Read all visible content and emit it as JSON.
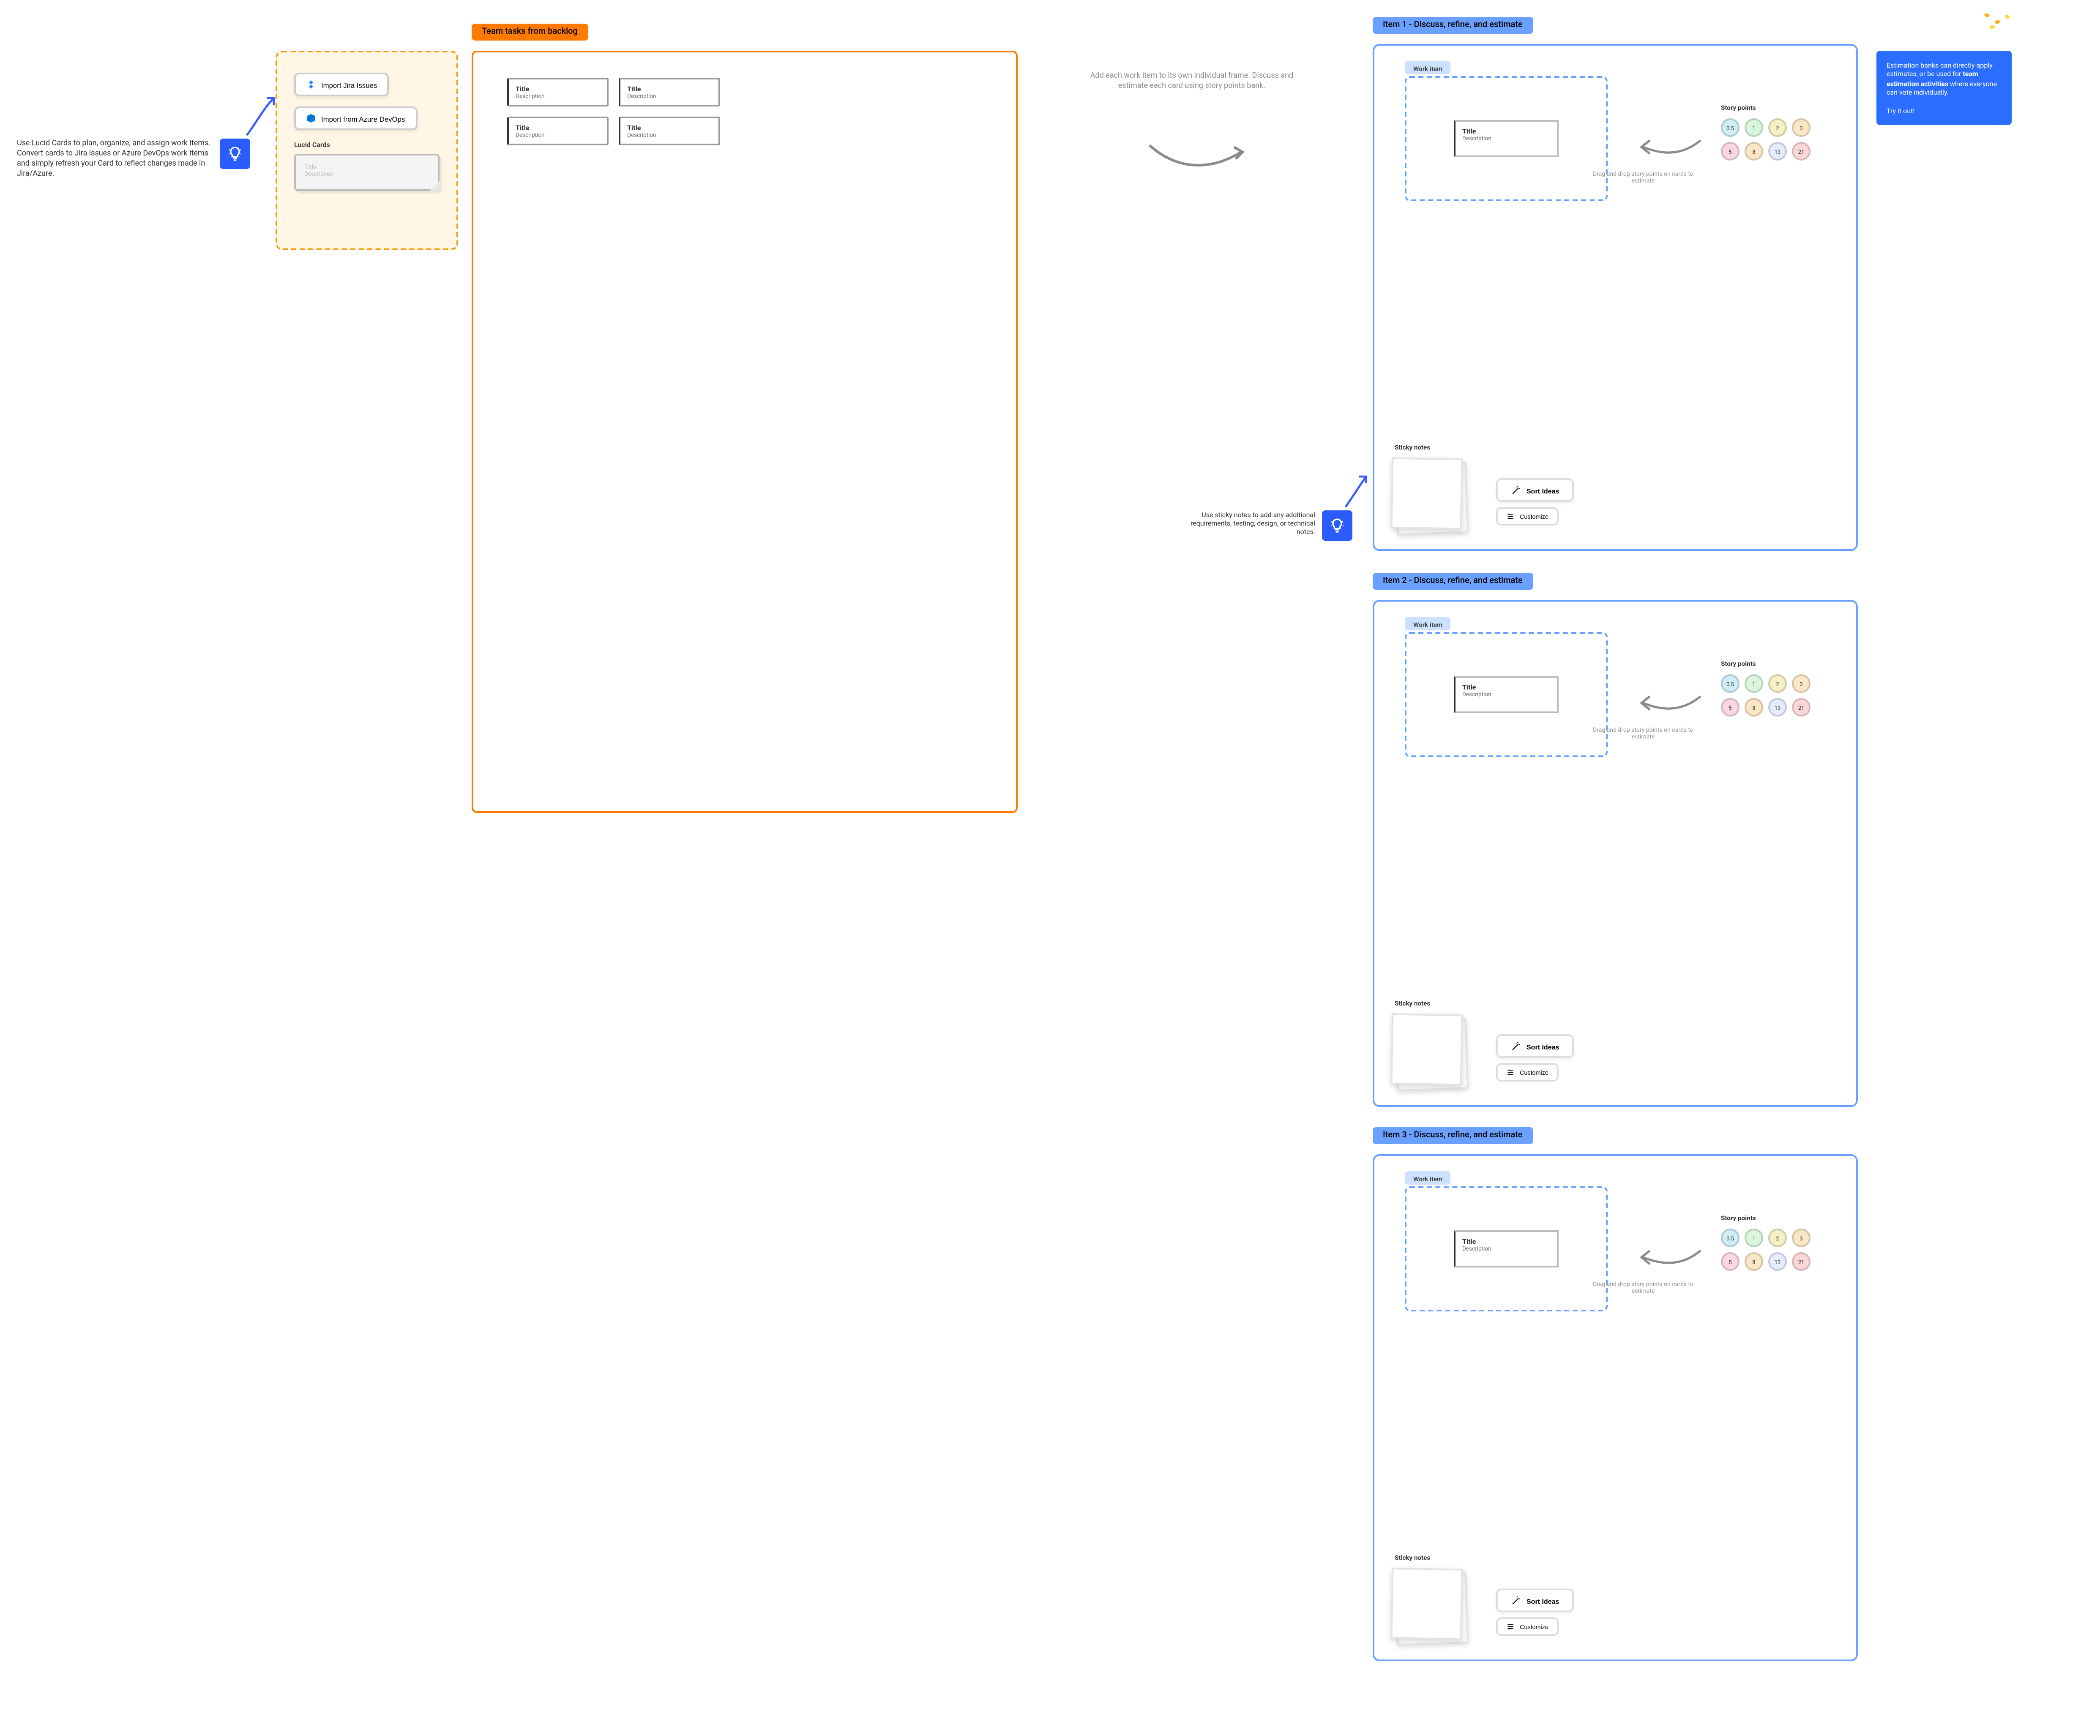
{
  "left_tip": {
    "text": "Use Lucid Cards to plan, organize, and assign work items. Convert cards to Jira issues or Azure DevOps work items and simply refresh your Card to reflect changes made in Jira/Azure."
  },
  "import_panel": {
    "jira_btn": "Import Jira Issues",
    "azure_btn": "Import from Azure DevOps",
    "lucid_label": "Lucid Cards",
    "card_title_placeholder": "Title",
    "card_desc_placeholder": "Description"
  },
  "backlog": {
    "title": "Team tasks from backlog",
    "cards": [
      {
        "title": "Title",
        "desc": "Description"
      },
      {
        "title": "Title",
        "desc": "Description"
      },
      {
        "title": "Title",
        "desc": "Description"
      },
      {
        "title": "Title",
        "desc": "Description"
      }
    ]
  },
  "mid_help": "Add each work item to its own individual frame. Discuss and estimate each card using story points bank.",
  "sticky_tip": "Use sticky notes to add any additional requirements, testing, design, or technical notes.",
  "story_points": {
    "title": "Story points",
    "values": [
      "0.5",
      "1",
      "2",
      "3",
      "5",
      "8",
      "13",
      "21"
    ],
    "colors": [
      "#cfeef7",
      "#d9f6dc",
      "#f5f0c6",
      "#fbe7c6",
      "#fbd7e1",
      "#fbe7c6",
      "#e6ecff",
      "#fdd7d7"
    ],
    "dd_help": "Drag and drop story points on cards to estimate"
  },
  "items": [
    {
      "title": "Item 1 - Discuss, refine, and estimate",
      "work_item_label": "Work item",
      "card_title": "Title",
      "card_desc": "Description",
      "sticky_label": "Sticky notes",
      "sort_btn": "Sort Ideas",
      "customize_btn": "Customize"
    },
    {
      "title": "Item 2 - Discuss, refine, and estimate",
      "work_item_label": "Work item",
      "card_title": "Title",
      "card_desc": "Description",
      "sticky_label": "Sticky notes",
      "sort_btn": "Sort Ideas",
      "customize_btn": "Customize"
    },
    {
      "title": "Item 3 - Discuss, refine, and estimate",
      "work_item_label": "Work item",
      "card_title": "Title",
      "card_desc": "Description",
      "sticky_label": "Sticky notes",
      "sort_btn": "Sort Ideas",
      "customize_btn": "Customize"
    }
  ],
  "callout": {
    "line1": "Estimation banks can directly apply estimates, or be used for ",
    "bold": "team estimation activities",
    "line2": " where everyone can vote individually.",
    "cta": "Try it out!"
  }
}
